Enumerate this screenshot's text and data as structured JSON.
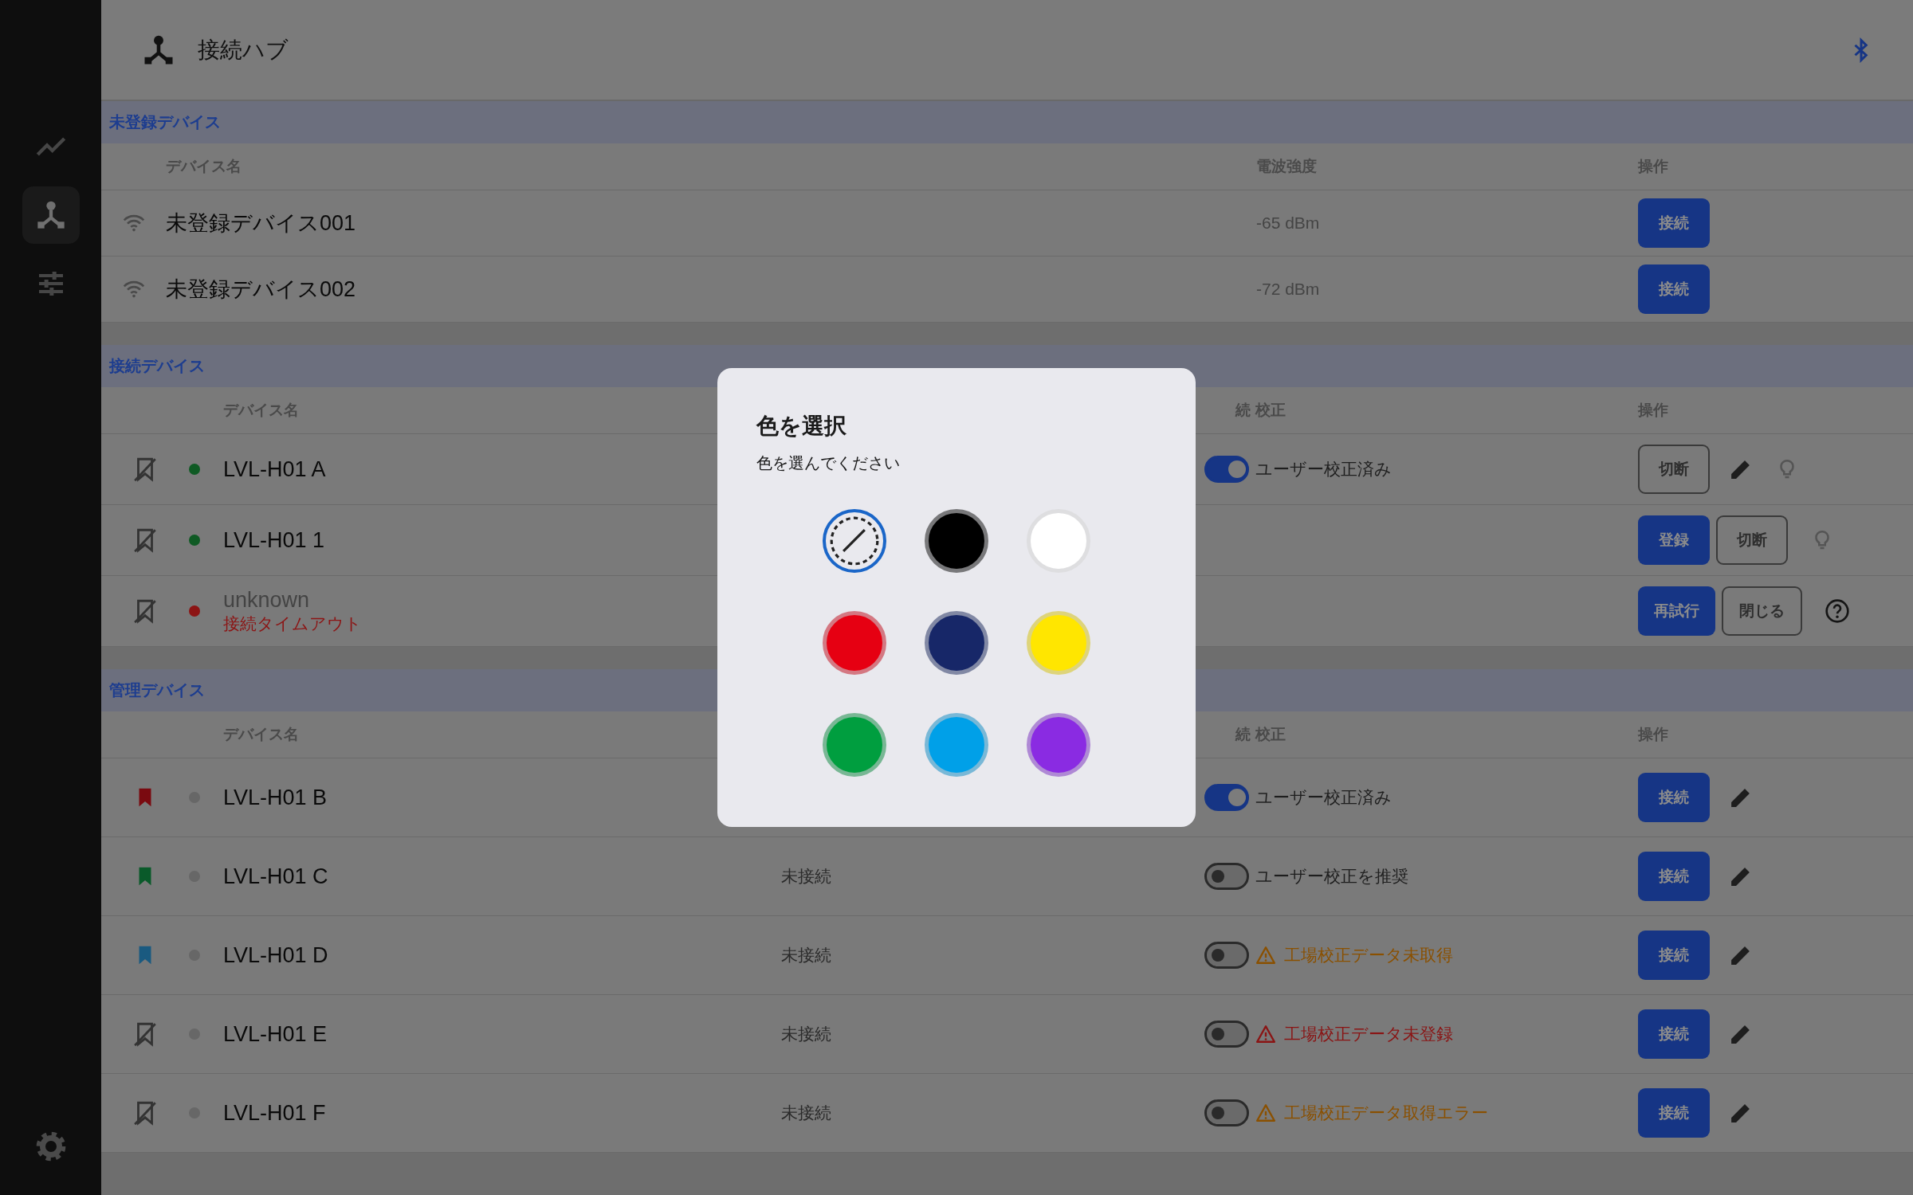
{
  "sidebar": {
    "items": [
      {
        "kind": "chart",
        "selected": false
      },
      {
        "kind": "hub",
        "selected": true
      },
      {
        "kind": "sliders",
        "selected": false
      }
    ]
  },
  "header": {
    "title": "接続ハブ"
  },
  "unregistered": {
    "title": "未登録デバイス",
    "columns": {
      "name": "デバイス名",
      "signal": "電波強度",
      "actions": "操作"
    },
    "rows": [
      {
        "name": "未登録デバイス001",
        "signal": "-65 dBm",
        "button": "接続"
      },
      {
        "name": "未登録デバイス002",
        "signal": "-72 dBm",
        "button": "接続"
      }
    ]
  },
  "connected": {
    "title": "接続デバイス",
    "columns": {
      "name": "デバイス名",
      "column_3": "続",
      "calibration": "校正",
      "actions": "操作"
    },
    "rows": [
      {
        "name": "LVL-H01 A",
        "dimmed": false,
        "color": "#0f5a24",
        "on": true,
        "calibration": "ユーザー校正済み",
        "buttons": [
          {
            "label": "切断",
            "kind": "outline"
          }
        ],
        "edit": true,
        "trailing": {
          "kind": "bulb"
        }
      },
      {
        "name": "LVL-H01 1",
        "dimmed": false,
        "color": "#0f5a24",
        "buttons": [
          {
            "label": "登録",
            "kind": "primary"
          },
          {
            "label": "切断",
            "kind": "outline"
          }
        ],
        "edit": false,
        "trailing": {
          "kind": "bulb"
        }
      },
      {
        "name": "unknown",
        "dimmed": true,
        "error": "接続タイムアウト",
        "color": "#8c1414",
        "buttons": [
          {
            "label": "再試行",
            "kind": "primary"
          },
          {
            "label": "閉じる",
            "kind": "outline"
          }
        ],
        "edit": false,
        "trailing": {
          "kind": "help"
        }
      }
    ]
  },
  "managed": {
    "title": "管理デバイス",
    "columns": {
      "name": "デバイス名",
      "column_3": "続",
      "calibration": "校正",
      "actions": "操作"
    },
    "rows": [
      {
        "name": "LVL-H01 B",
        "bookmark": {
          "color": "#7a0a10"
        },
        "color": "#676767",
        "on": true,
        "calibration": {
          "text": "ユーザー校正済み",
          "kind": "plain"
        },
        "button": "接続"
      },
      {
        "name": "LVL-H01 C",
        "bookmark": {
          "color": "#0a5a2a"
        },
        "color": "#676767",
        "status": "未接続",
        "on": false,
        "calibration": {
          "text": "ユーザー校正を推奨",
          "kind": "plain"
        },
        "button": "接続"
      },
      {
        "name": "LVL-H01 D",
        "bookmark": {
          "color": "#1a5a80"
        },
        "color": "#676767",
        "status": "未接続",
        "on": false,
        "calibration": {
          "text": "工場校正データ未取得",
          "kind": "warning"
        },
        "button": "接続"
      },
      {
        "name": "LVL-H01 E",
        "color": "#676767",
        "status": "未接続",
        "on": false,
        "calibration": {
          "text": "工場校正データ未登録",
          "kind": "error"
        },
        "button": "接続"
      },
      {
        "name": "LVL-H01 F",
        "color": "#676767",
        "status": "未接続",
        "on": false,
        "calibration": {
          "text": "工場校正データ取得エラー",
          "kind": "warning"
        },
        "button": "接続"
      }
    ]
  },
  "modal": {
    "title": "色を選択",
    "subtitle": "色を選んでください",
    "swatches": [
      {
        "kind": "none",
        "selected": true
      },
      {
        "kind": "color",
        "color": "#000000",
        "selected": false
      },
      {
        "kind": "color",
        "color": "#ffffff",
        "selected": false
      },
      {
        "kind": "color",
        "color": "#e60012",
        "selected": false
      },
      {
        "kind": "color",
        "color": "#172768",
        "selected": false
      },
      {
        "kind": "color",
        "color": "#ffe600",
        "selected": false
      },
      {
        "kind": "color",
        "color": "#009e3f",
        "selected": false
      },
      {
        "kind": "color",
        "color": "#00a0e8",
        "selected": false
      },
      {
        "kind": "color",
        "color": "#8a2be2",
        "selected": false
      }
    ]
  }
}
